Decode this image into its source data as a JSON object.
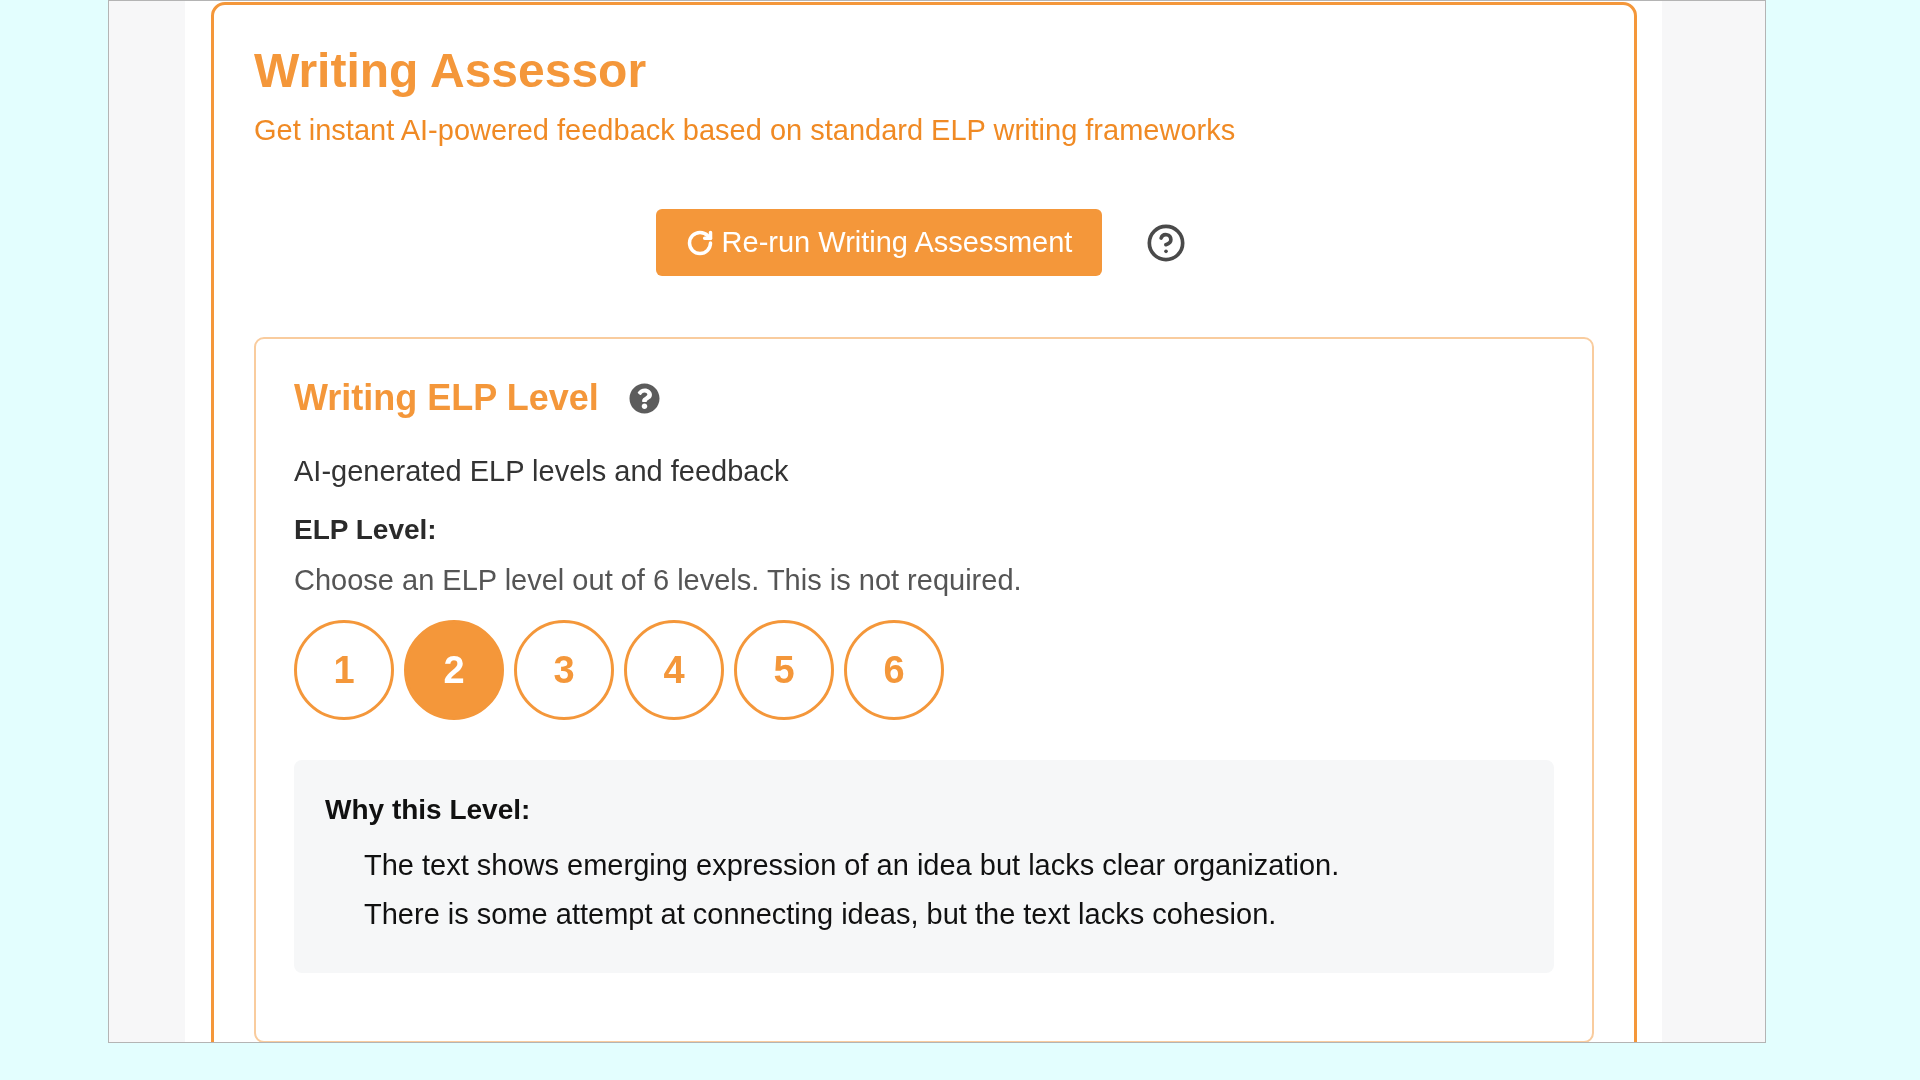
{
  "header": {
    "title": "Writing Assessor",
    "subtitle": "Get instant AI-powered feedback based on standard ELP writing frameworks"
  },
  "actions": {
    "rerun_button": {
      "label": "Re-run Writing Assessment"
    }
  },
  "elp_card": {
    "title": "Writing ELP Level",
    "description": "AI-generated ELP levels and feedback",
    "level_label": "ELP Level:",
    "level_hint": "Choose an ELP level out of 6 levels. This is not required.",
    "levels": [
      {
        "label": "1",
        "selected": false
      },
      {
        "label": "2",
        "selected": true
      },
      {
        "label": "3",
        "selected": false
      },
      {
        "label": "4",
        "selected": false
      },
      {
        "label": "5",
        "selected": false
      },
      {
        "label": "6",
        "selected": false
      }
    ],
    "reason": {
      "title": "Why this Level:",
      "lines": [
        "The text shows emerging expression of an idea but lacks clear organization.",
        "There is some attempt at connecting ideas, but the text lacks cohesion."
      ]
    }
  }
}
